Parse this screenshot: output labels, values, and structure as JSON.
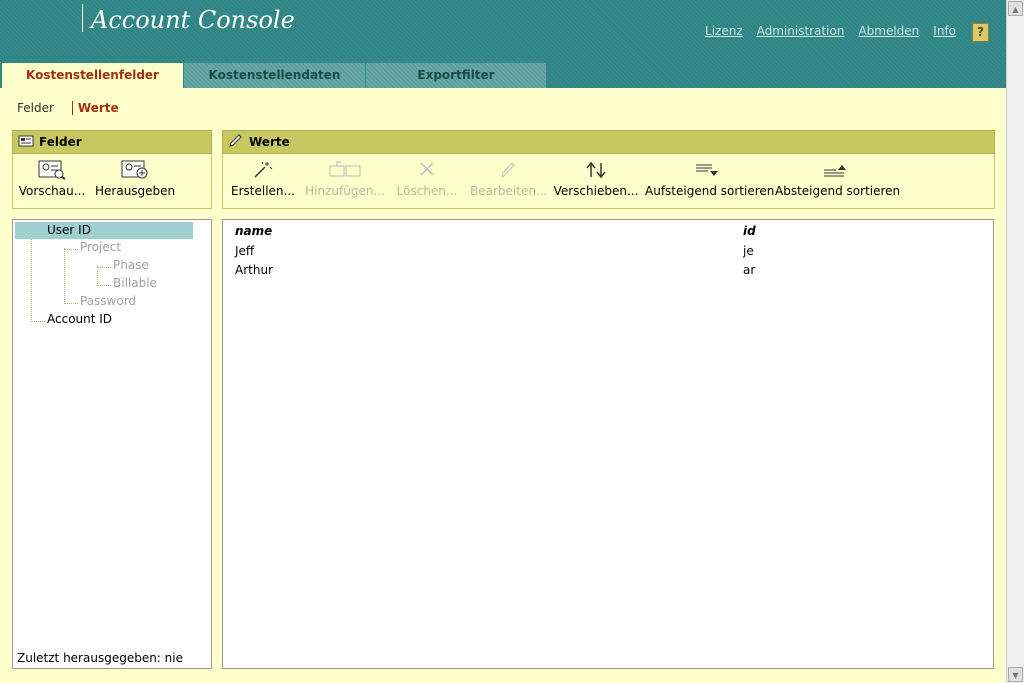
{
  "header": {
    "title": "Account Console",
    "links": [
      "Lizenz",
      "Administration",
      "Abmelden",
      "Info"
    ],
    "help_label": "?"
  },
  "tabs": [
    {
      "label": "Kostenstellenfelder",
      "active": true
    },
    {
      "label": "Kostenstellendaten",
      "active": false
    },
    {
      "label": "Exportfilter",
      "active": false
    }
  ],
  "subnav": {
    "felder": "Felder",
    "werte": "Werte"
  },
  "felder_panel": {
    "title": "Felder",
    "buttons": [
      {
        "label": "Vorschau...",
        "icon": "preview-icon"
      },
      {
        "label": "Herausgeben",
        "icon": "publish-icon"
      }
    ],
    "tree": [
      {
        "label": "User ID",
        "selected": true,
        "enabled": true
      },
      {
        "label": "Project",
        "enabled": false
      },
      {
        "label": "Phase",
        "enabled": false
      },
      {
        "label": "Billable",
        "enabled": false
      },
      {
        "label": "Password",
        "enabled": false
      },
      {
        "label": "Account ID",
        "enabled": true
      }
    ],
    "last_published": "Zuletzt herausgegeben: nie"
  },
  "werte_panel": {
    "title": "Werte",
    "buttons": [
      {
        "label": "Erstellen...",
        "icon": "create-icon",
        "enabled": true
      },
      {
        "label": "Hinzufügen...",
        "icon": "add-icon",
        "enabled": false
      },
      {
        "label": "Löschen...",
        "icon": "delete-icon",
        "enabled": false
      },
      {
        "label": "Bearbeiten...",
        "icon": "edit-icon",
        "enabled": false
      },
      {
        "label": "Verschieben...",
        "icon": "move-icon",
        "enabled": true
      },
      {
        "label": "Aufsteigend sortieren",
        "icon": "sort-ascending-icon",
        "enabled": true
      },
      {
        "label": "Absteigend sortieren",
        "icon": "sort-descending-icon",
        "enabled": true
      }
    ],
    "columns": [
      "name",
      "id"
    ],
    "rows": [
      {
        "name": "Jeff",
        "id": "je"
      },
      {
        "name": "Arthur",
        "id": "ar"
      }
    ]
  }
}
